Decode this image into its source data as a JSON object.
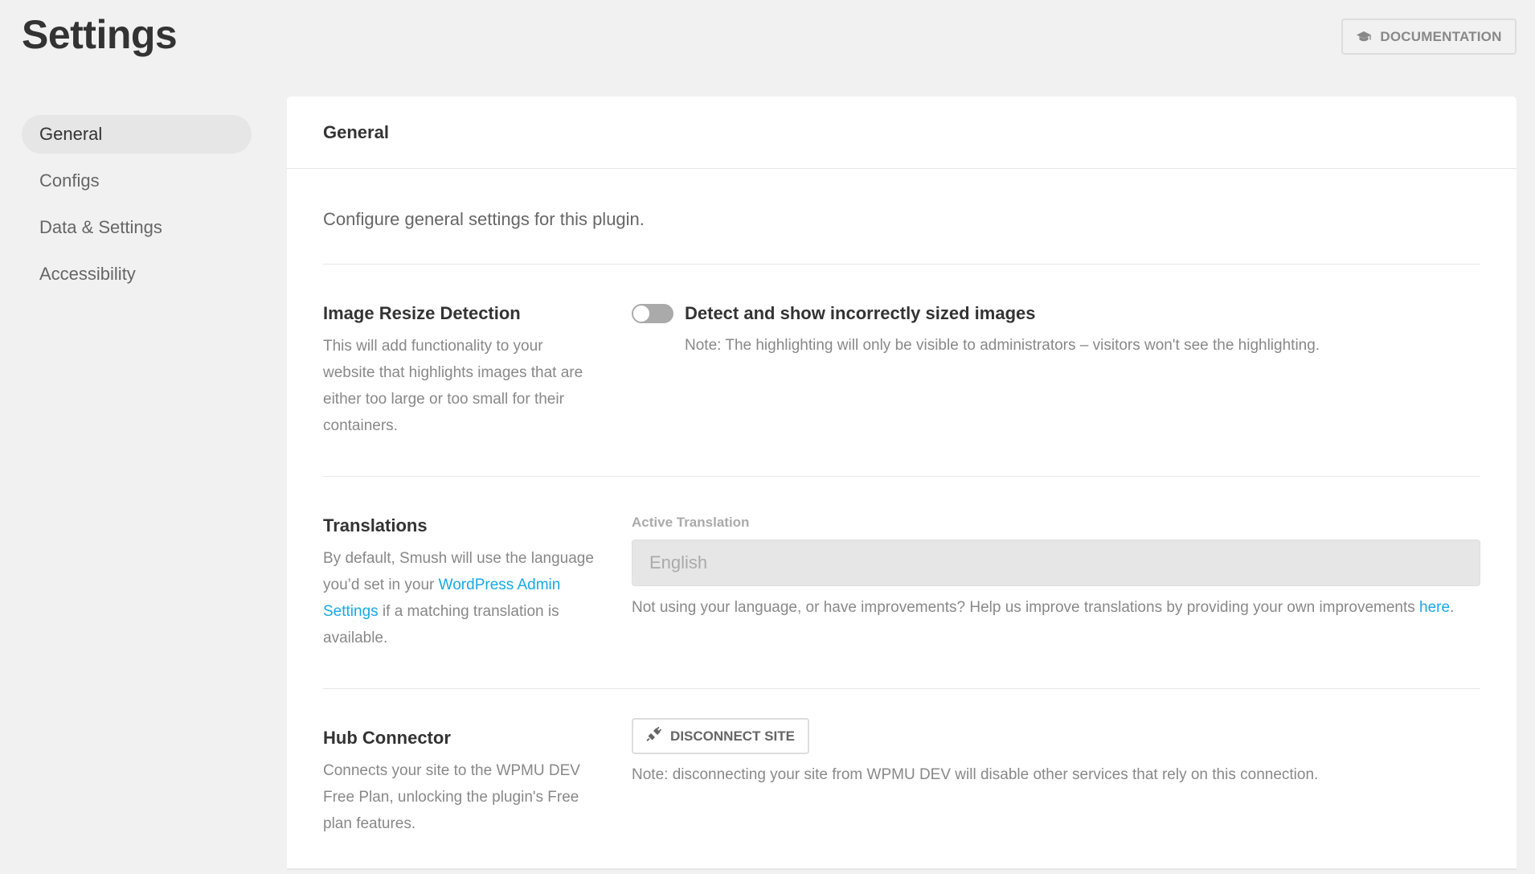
{
  "header": {
    "title": "Settings",
    "documentation_label": "DOCUMENTATION"
  },
  "sidebar": {
    "items": [
      {
        "label": "General",
        "active": true
      },
      {
        "label": "Configs",
        "active": false
      },
      {
        "label": "Data & Settings",
        "active": false
      },
      {
        "label": "Accessibility",
        "active": false
      }
    ]
  },
  "panel": {
    "title": "General",
    "intro": "Configure general settings for this plugin.",
    "image_resize": {
      "title": "Image Resize Detection",
      "description": "This will add functionality to your website that highlights images that are either too large or too small for their containers.",
      "toggle_label": "Detect and show incorrectly sized images",
      "toggle_on": false,
      "note": "Note: The highlighting will only be visible to administrators – visitors won't see the highlighting."
    },
    "translations": {
      "title": "Translations",
      "description_before": "By default, Smush will use the language you’d set in your ",
      "description_link": "WordPress Admin Settings",
      "description_after": " if a matching translation is available.",
      "field_label": "Active Translation",
      "selected_value": "English",
      "help_before": "Not using your language, or have improvements? Help us improve translations by providing your own improvements ",
      "help_link": "here",
      "help_after": "."
    },
    "hub_connector": {
      "title": "Hub Connector",
      "description": "Connects your site to the WPMU DEV Free Plan, unlocking the plugin's Free plan features.",
      "button_label": "DISCONNECT SITE",
      "note": "Note: disconnecting your site from WPMU DEV will disable other services that rely on this connection."
    }
  },
  "colors": {
    "background": "#f1f1f1",
    "panel": "#ffffff",
    "link": "#17a8e3",
    "toggle_off": "#aaaaaa"
  },
  "icons": {
    "documentation": "academic-cap-icon",
    "disconnect": "unplug-icon"
  }
}
